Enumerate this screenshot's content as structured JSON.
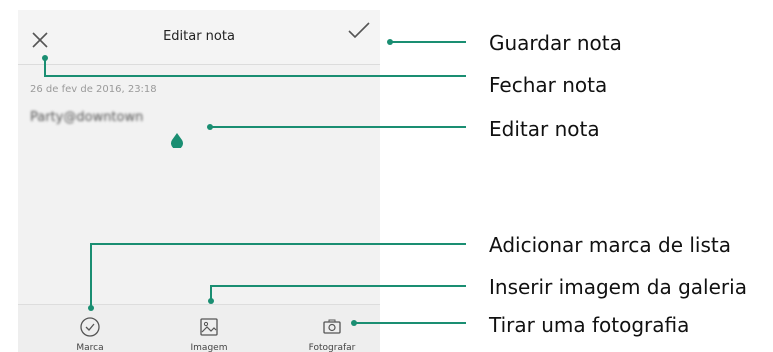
{
  "screen": {
    "title": "Editar nota",
    "date": "26 de fev de 2016, 23:18",
    "note_text": "Party@downtown"
  },
  "toolbar": {
    "items": [
      {
        "label": "Marca",
        "icon": "checklist-icon"
      },
      {
        "label": "Imagem",
        "icon": "image-icon"
      },
      {
        "label": "Fotografar",
        "icon": "camera-icon"
      }
    ]
  },
  "callouts": [
    {
      "label": "Guardar nota"
    },
    {
      "label": "Fechar nota"
    },
    {
      "label": "Editar nota"
    },
    {
      "label": "Adicionar marca de lista"
    },
    {
      "label": "Inserir imagem da galeria"
    },
    {
      "label": "Tirar uma fotografia"
    }
  ],
  "colors": {
    "accent": "#1a8e72",
    "background": "#f2f2f2",
    "toolbar": "#eeeeee"
  }
}
